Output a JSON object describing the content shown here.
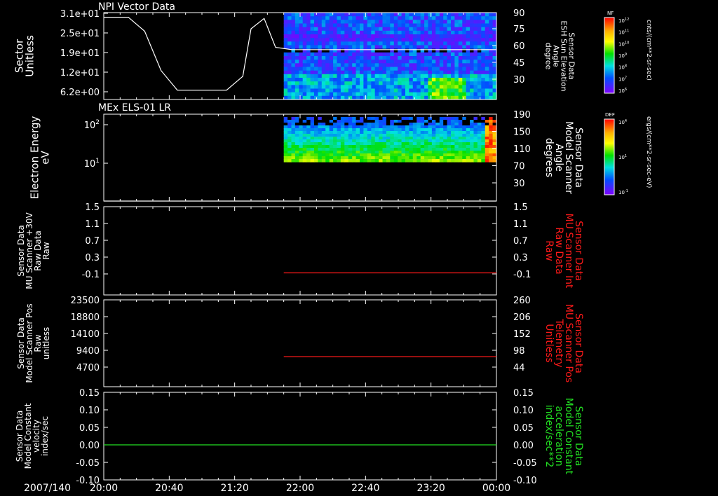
{
  "date_label": "2007/140",
  "x_axis": {
    "type": "time",
    "ticks": [
      "20:00",
      "20:40",
      "21:20",
      "22:00",
      "22:40",
      "23:20",
      "00:00"
    ]
  },
  "colors": {
    "background": "#000000",
    "foreground": "#ffffff",
    "red_series": "#ff1a1a",
    "green_series": "#22e022"
  },
  "colorbars": [
    {
      "name": "NF",
      "units": "cnts/(cm**2-sr-sec)",
      "ticks": [
        "10^12",
        "10^11",
        "10^10",
        "10^9",
        "10^8",
        "10^7",
        "10^6"
      ]
    },
    {
      "name": "DEF",
      "units": "ergs/(cm**2-sr-sec-eV)",
      "ticks": [
        "10^4",
        "10^1",
        "10^-1"
      ]
    }
  ],
  "chart_data": [
    {
      "type": "spectrogram+line",
      "title": "NPI Vector Data",
      "ylabel": [
        "Sector",
        "Unitless"
      ],
      "yticks": [
        "3.1e+01",
        "2.5e+01",
        "1.9e+01",
        "1.2e+01",
        "6.2e+00"
      ],
      "y2label": [
        "Sensor Data",
        "ESH Sun Elevation",
        "Angle",
        "degree"
      ],
      "y2ticks": [
        90,
        75,
        60,
        45,
        30
      ],
      "y2lim": [
        15,
        90
      ],
      "spectrogram_time_range": [
        "21:50",
        "00:00"
      ],
      "line_series": {
        "axis": "right",
        "x": [
          "20:00",
          "20:15",
          "20:25",
          "20:35",
          "20:45",
          "21:00",
          "21:15",
          "21:25",
          "21:30",
          "21:38",
          "21:45",
          "21:55",
          "22:40",
          "23:20",
          "00:00"
        ],
        "values": [
          86,
          86,
          74,
          40,
          23,
          23,
          23,
          35,
          76,
          85,
          60,
          58,
          58,
          58,
          58
        ]
      }
    },
    {
      "type": "spectrogram+line",
      "title": "MEx ELS-01 LR",
      "ylabel": [
        "Electron Energy",
        "eV"
      ],
      "yticks": [
        "10^2",
        "10^1"
      ],
      "y2label": [
        "Sensor Data",
        "Model Scanner",
        "Angle",
        "degrees"
      ],
      "y2ticks": [
        190,
        150,
        110,
        70,
        30
      ],
      "y2lim": [
        10,
        190
      ],
      "spectrogram_time_range": [
        "21:50",
        "00:00"
      ],
      "line_series": {
        "axis": "right",
        "x": [
          "20:00",
          "00:00"
        ],
        "values": [
          10,
          10
        ]
      }
    },
    {
      "type": "line",
      "ylabel": [
        "Sensor Data",
        "MU Scanner +30V",
        "Raw Data",
        "Raw"
      ],
      "yticks": [
        "1.5",
        "1.1",
        "0.7",
        "0.3",
        "-0.1"
      ],
      "ylim": [
        -0.5,
        1.5
      ],
      "y2label": [
        "Sensor Data",
        "MU Scanner Int",
        "Raw Data",
        "Raw"
      ],
      "y2ticks": [
        "1.5",
        "1.1",
        "0.7",
        "0.3",
        "-0.1"
      ],
      "series": [
        {
          "axis": "right",
          "color": "#ff1a1a",
          "x": [
            "21:50",
            "00:00"
          ],
          "values": [
            0.0,
            0.0
          ]
        }
      ]
    },
    {
      "type": "line",
      "ylabel": [
        "Sensor Data",
        "Model Scanner Pos",
        "Raw",
        "unitless"
      ],
      "yticks": [
        "23500",
        "18800",
        "14100",
        "9400",
        "4700"
      ],
      "ylim": [
        0,
        23500
      ],
      "y2label": [
        "Sensor Data",
        "MU Scanner Pos",
        "Telemetry",
        "Unitless"
      ],
      "y2ticks": [
        "260",
        "206",
        "152",
        "98",
        "44"
      ],
      "y2lim": [
        0,
        260
      ],
      "series": [
        {
          "axis": "right",
          "color": "#ff1a1a",
          "x": [
            "21:50",
            "00:00"
          ],
          "values": [
            90,
            90
          ]
        }
      ]
    },
    {
      "type": "line",
      "ylabel": [
        "Sensor Data",
        "Model Constant",
        "velocity",
        "index/sec"
      ],
      "yticks": [
        "0.15",
        "0.10",
        "0.05",
        "0.00",
        "-0.05",
        "-0.10"
      ],
      "ylim": [
        -0.1,
        0.15
      ],
      "y2label": [
        "Sensor Data",
        "Model Constant",
        "acceleration",
        "index/sec**2"
      ],
      "y2ticks": [
        "0.15",
        "0.10",
        "0.05",
        "0.00",
        "-0.05",
        "-0.10"
      ],
      "series": [
        {
          "axis": "left",
          "color": "#22e022",
          "x": [
            "20:00",
            "00:00"
          ],
          "values": [
            0.0,
            0.0
          ]
        }
      ]
    }
  ]
}
